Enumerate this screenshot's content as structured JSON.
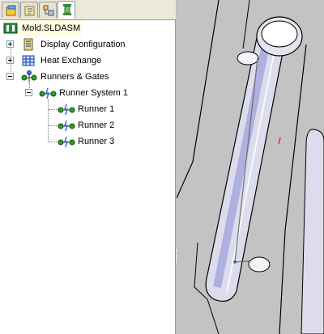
{
  "panel": {
    "tabs": [
      {
        "icon": "feature-manager-icon",
        "active": false
      },
      {
        "icon": "property-manager-icon",
        "active": false
      },
      {
        "icon": "configuration-manager-icon",
        "active": false
      },
      {
        "icon": "mold-tree-icon",
        "active": true
      }
    ]
  },
  "tree": {
    "root": {
      "label": "Mold.SLDASM",
      "icon": "assembly-icon"
    },
    "items": [
      {
        "label": "Display Configuration",
        "icon": "display-config-icon",
        "expander": "plus"
      },
      {
        "label": "Heat Exchange",
        "icon": "heat-exchange-icon",
        "expander": "plus"
      },
      {
        "label": "Runners & Gates",
        "icon": "runners-gates-icon",
        "expander": "minus"
      },
      {
        "label": "Runner System 1",
        "icon": "runner-system-icon",
        "expander": "minus"
      },
      {
        "label": "Runner 1",
        "icon": "runner-icon"
      },
      {
        "label": "Runner 2",
        "icon": "runner-icon"
      },
      {
        "label": "Runner 3",
        "icon": "runner-icon"
      }
    ]
  },
  "viewport": {
    "background": "#c3c3c3",
    "part_color": "#dcdcec",
    "edge_color": "#000000"
  }
}
